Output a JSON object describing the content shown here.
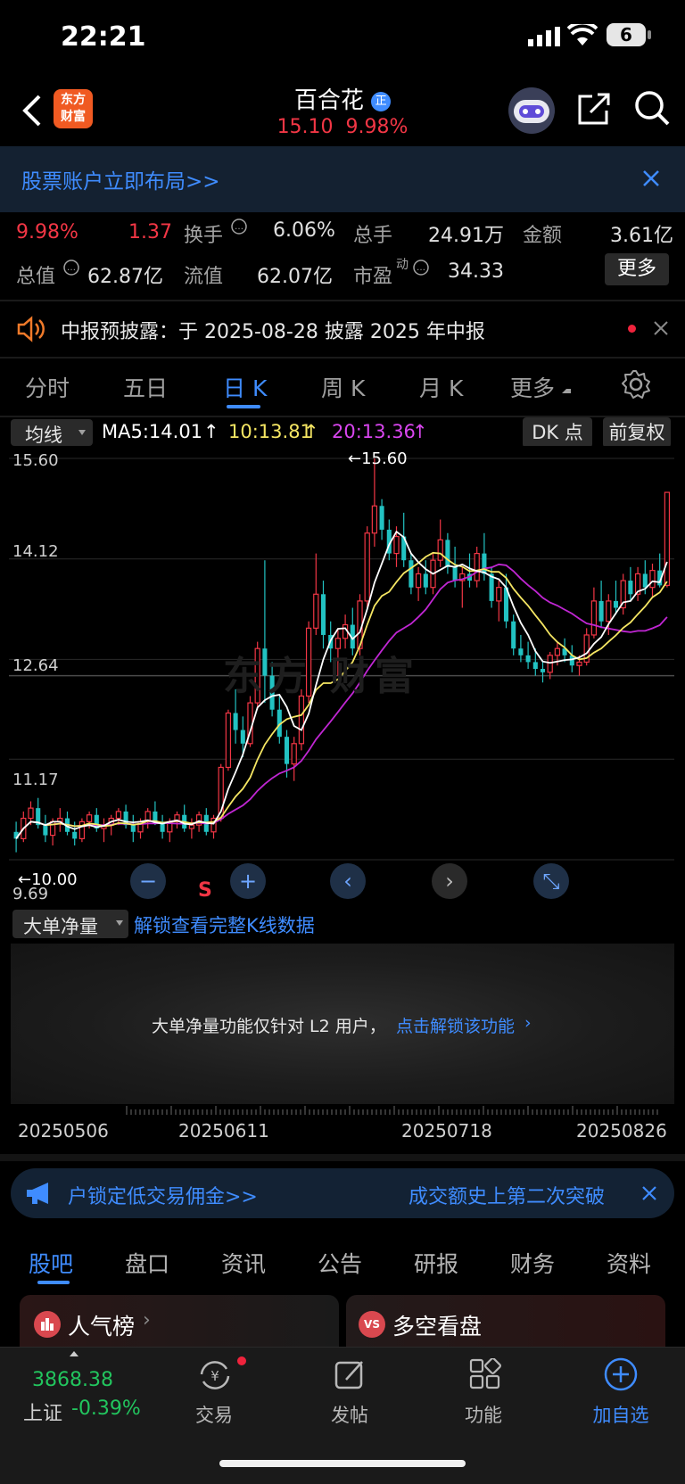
{
  "status": {
    "time": "22:21",
    "battery": "6"
  },
  "header": {
    "logo_line1": "东方",
    "logo_line2": "财富",
    "title": "百合花",
    "badge": "正",
    "price": "15.10",
    "change_pct": "9.98%"
  },
  "banner": {
    "text": "股票账户立即布局>>"
  },
  "stats": {
    "pct": "9.98%",
    "chg": "1.37",
    "turnover_label": "换手",
    "turnover": "6.06%",
    "total_hand_label": "总手",
    "total_hand": "24.91万",
    "amount_label": "金额",
    "amount": "3.61亿",
    "total_value_label": "总值",
    "total_value": "62.87亿",
    "float_value_label": "流值",
    "float_value": "62.07亿",
    "pe_label": "市盈",
    "pe_sup": "动",
    "pe": "34.33",
    "more_button": "更多"
  },
  "notice": {
    "text": "中报预披露：于 2025-08-28 披露 2025 年中报"
  },
  "ktabs": [
    "分时",
    "五日",
    "日 K",
    "周 K",
    "月 K",
    "更多"
  ],
  "chart_bar": {
    "ma_select": "均线",
    "ma5": "MA5:14.01",
    "ma10": "10:13.81",
    "ma20": "20:13.36",
    "dk_button": "DK 点",
    "adjust_button": "前复权"
  },
  "chart_data": {
    "type": "candlestick",
    "y_ticks": [
      "15.60",
      "14.12",
      "12.64",
      "11.17",
      "9.69"
    ],
    "ylim": [
      9.69,
      15.6
    ],
    "annotations": {
      "high": "←15.60",
      "low": "←10.00",
      "signal": "S"
    },
    "ohlc": [
      [
        10.1,
        10.25,
        9.8,
        10.0
      ],
      [
        10.0,
        10.4,
        9.95,
        10.3
      ],
      [
        10.3,
        10.55,
        10.2,
        10.45
      ],
      [
        10.45,
        10.6,
        10.15,
        10.2
      ],
      [
        10.2,
        10.35,
        9.95,
        10.05
      ],
      [
        10.05,
        10.3,
        9.9,
        10.25
      ],
      [
        10.25,
        10.45,
        10.1,
        10.3
      ],
      [
        10.3,
        10.4,
        10.05,
        10.1
      ],
      [
        10.1,
        10.25,
        9.9,
        10.0
      ],
      [
        10.0,
        10.3,
        9.95,
        10.25
      ],
      [
        10.25,
        10.4,
        10.15,
        10.35
      ],
      [
        10.35,
        10.45,
        10.1,
        10.15
      ],
      [
        10.15,
        10.3,
        9.95,
        10.2
      ],
      [
        10.2,
        10.35,
        10.05,
        10.3
      ],
      [
        10.3,
        10.45,
        10.2,
        10.4
      ],
      [
        10.4,
        10.5,
        10.15,
        10.2
      ],
      [
        10.2,
        10.35,
        9.95,
        10.1
      ],
      [
        10.1,
        10.3,
        10.0,
        10.25
      ],
      [
        10.25,
        10.45,
        10.15,
        10.4
      ],
      [
        10.4,
        10.55,
        10.2,
        10.25
      ],
      [
        10.25,
        10.35,
        10.0,
        10.1
      ],
      [
        10.1,
        10.3,
        9.95,
        10.25
      ],
      [
        10.25,
        10.4,
        10.15,
        10.35
      ],
      [
        10.35,
        10.5,
        10.1,
        10.15
      ],
      [
        10.15,
        10.3,
        10.0,
        10.2
      ],
      [
        10.2,
        10.4,
        10.1,
        10.35
      ],
      [
        10.35,
        10.45,
        10.05,
        10.1
      ],
      [
        10.1,
        10.35,
        10.0,
        10.3
      ],
      [
        10.3,
        11.1,
        10.25,
        11.05
      ],
      [
        11.05,
        11.9,
        11.0,
        11.85
      ],
      [
        11.85,
        12.2,
        11.4,
        11.6
      ],
      [
        11.6,
        11.8,
        11.2,
        11.4
      ],
      [
        11.4,
        12.1,
        11.35,
        12.0
      ],
      [
        12.0,
        12.9,
        11.9,
        12.8
      ],
      [
        12.8,
        14.1,
        12.0,
        12.4
      ],
      [
        12.4,
        12.6,
        11.8,
        11.9
      ],
      [
        11.9,
        12.1,
        11.4,
        11.5
      ],
      [
        11.5,
        11.6,
        10.9,
        11.1
      ],
      [
        11.1,
        11.5,
        10.85,
        11.4
      ],
      [
        11.4,
        12.2,
        11.3,
        12.1
      ],
      [
        12.1,
        13.2,
        12.0,
        13.1
      ],
      [
        13.1,
        14.2,
        13.0,
        13.6
      ],
      [
        13.6,
        13.8,
        12.8,
        13.0
      ],
      [
        13.0,
        13.2,
        12.6,
        12.8
      ],
      [
        12.8,
        13.1,
        12.4,
        12.95
      ],
      [
        12.95,
        13.3,
        12.8,
        13.15
      ],
      [
        13.15,
        13.4,
        12.7,
        12.8
      ],
      [
        12.8,
        13.6,
        12.7,
        13.5
      ],
      [
        13.5,
        14.6,
        13.4,
        14.5
      ],
      [
        14.5,
        15.6,
        14.3,
        14.9
      ],
      [
        14.9,
        15.0,
        14.4,
        14.55
      ],
      [
        14.55,
        14.7,
        14.1,
        14.2
      ],
      [
        14.2,
        14.6,
        14.0,
        14.45
      ],
      [
        14.45,
        14.8,
        14.0,
        14.1
      ],
      [
        14.1,
        14.2,
        13.6,
        13.7
      ],
      [
        13.7,
        14.0,
        13.5,
        13.9
      ],
      [
        13.9,
        14.1,
        13.6,
        13.7
      ],
      [
        13.7,
        14.2,
        13.6,
        14.1
      ],
      [
        14.1,
        14.7,
        14.0,
        14.4
      ],
      [
        14.4,
        14.5,
        13.9,
        14.0
      ],
      [
        14.0,
        14.3,
        13.7,
        13.8
      ],
      [
        13.8,
        14.0,
        13.4,
        13.9
      ],
      [
        13.9,
        14.2,
        13.7,
        13.8
      ],
      [
        13.8,
        14.3,
        13.7,
        14.2
      ],
      [
        14.2,
        14.5,
        13.8,
        13.9
      ],
      [
        13.9,
        14.0,
        13.4,
        13.5
      ],
      [
        13.5,
        13.8,
        13.2,
        13.7
      ],
      [
        13.7,
        13.9,
        13.1,
        13.2
      ],
      [
        13.2,
        13.3,
        12.7,
        12.8
      ],
      [
        12.8,
        13.0,
        12.6,
        12.7
      ],
      [
        12.7,
        12.9,
        12.5,
        12.6
      ],
      [
        12.6,
        12.8,
        12.4,
        12.5
      ],
      [
        12.5,
        12.6,
        12.3,
        12.45
      ],
      [
        12.45,
        12.75,
        12.35,
        12.7
      ],
      [
        12.7,
        12.9,
        12.55,
        12.8
      ],
      [
        12.8,
        12.95,
        12.6,
        12.7
      ],
      [
        12.7,
        12.85,
        12.45,
        12.55
      ],
      [
        12.55,
        12.7,
        12.4,
        12.6
      ],
      [
        12.6,
        13.1,
        12.55,
        13.0
      ],
      [
        13.0,
        13.7,
        12.95,
        13.5
      ],
      [
        13.5,
        13.8,
        13.1,
        13.2
      ],
      [
        13.2,
        13.6,
        13.0,
        13.5
      ],
      [
        13.5,
        13.8,
        13.3,
        13.4
      ],
      [
        13.4,
        13.9,
        13.3,
        13.8
      ],
      [
        13.8,
        14.0,
        13.5,
        13.6
      ],
      [
        13.6,
        14.0,
        13.5,
        13.9
      ],
      [
        13.9,
        14.1,
        13.6,
        13.7
      ],
      [
        13.7,
        14.05,
        13.55,
        13.95
      ],
      [
        13.95,
        14.2,
        13.7,
        13.73
      ],
      [
        13.73,
        15.1,
        13.7,
        15.1
      ]
    ]
  },
  "controls": {
    "minus": "−",
    "plus": "+",
    "prev": "‹",
    "next": "›",
    "expand": "⤡"
  },
  "indicator": {
    "select": "大单净量",
    "unlock_link": "解锁查看完整K线数据"
  },
  "locked": {
    "text": "大单净量功能仅针对 L2 用户，",
    "link": "点击解锁该功能"
  },
  "dates": [
    "20250506",
    "20250611",
    "20250718",
    "20250826"
  ],
  "ticker": {
    "left": "户锁定低交易佣金>>",
    "right": "成交额史上第二次突破"
  },
  "btabs": [
    "股吧",
    "盘口",
    "资讯",
    "公告",
    "研报",
    "财务",
    "资料"
  ],
  "cards": {
    "left": "人气榜",
    "right": "多空看盘",
    "right_badge": "VS"
  },
  "bottom_nav": {
    "index_value": "3868.38",
    "index_name": "上证",
    "index_chg": "-0.39%",
    "trade": "交易",
    "post": "发帖",
    "func": "功能",
    "add": "加自选"
  },
  "colors": {
    "up": "#f23645",
    "down": "#22c2c2",
    "accent": "#3f8cff",
    "ma5": "#ffffff",
    "ma10": "#f5e663",
    "ma20": "#c026d3"
  }
}
